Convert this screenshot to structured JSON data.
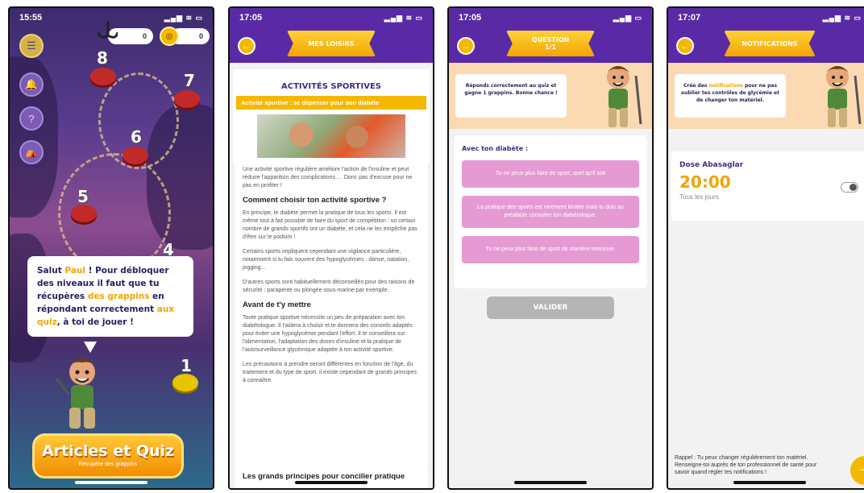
{
  "screen1": {
    "time": "15:55",
    "status_icons": "▂▄▆ ≋ ▭",
    "counter_left": "0",
    "counter_right": "0",
    "levels": [
      "8",
      "7",
      "6",
      "5",
      "4",
      "1"
    ],
    "speech": {
      "t1": "Salut ",
      "name": "Paul",
      "t2": " ! Pour débloquer des niveaux il faut que tu récupères ",
      "h1": "des grappins",
      "t3": " en répondant correctement ",
      "h2": "aux quiz",
      "t4": ", à toi de jouer !"
    },
    "cta_title": "Articles et Quiz",
    "cta_subtitle": "Récupère des grappins",
    "side_icons": [
      "menu-icon",
      "bell-icon",
      "question-icon",
      "tent-icon"
    ]
  },
  "screen2": {
    "time": "17:05",
    "status_icons": "▂▄▆ ≋ ▭",
    "header_title": "MES LOISIRS",
    "article_title": "ACTIVITÉS SPORTIVES",
    "subtitle_bar": "Activité sportive : se dépenser pour son diabète",
    "intro": "Une activité sportive régulière améliore l'action de l'insuline et peut réduire l'apparition des complications…. Donc pas d'excuse pour ne pas en profiter !",
    "h1": "Comment choisir ton activité sportive ?",
    "p1": "En principe, le diabète permet la pratique de tous les sports. Il est même tout à fait possible de faire du sport de compétition : un certain nombre de grands sportifs ont un diabète, et cela ne les empêche pas d'être sur le podium !",
    "p2": "Certains sports impliquent cependant une vigilance particulière, notamment si tu fais souvent des hypoglycémies : danse, natation, jogging…",
    "p3": "D'autres sports sont habituellement déconseillés pour des raisons de sécurité : parapente ou plongée sous-marine par exemple.",
    "h2": "Avant de t'y mettre",
    "p4": "Toute pratique sportive nécessite un peu de préparation avec ton diabétologue. Il t'aidera à choisir et te donnera des conseils adaptés pour éviter une hypoglycémie pendant l'effort. Il te conseillera sur l'alimentation, l'adaptation des doses d'insuline et la pratique de l'autosurveillance glycémique adaptée à ton activité sportive.",
    "p5": "Les précautions à prendre seront différentes en fonction de l'âge, du traitement et du type de sport, il existe cependant de grands principes à connaître.",
    "next_heading": "Les grands principes pour concilier pratique"
  },
  "screen3": {
    "time": "17:05",
    "status_icons": "▂▄▆ ▭",
    "header_line1": "QUESTION",
    "header_line2": "1/1",
    "instruction": "Réponds correctement au quiz et gagne 1 grappins. Bonne chance !",
    "question": "Avec ton diabète :",
    "answers": [
      "Tu ne peux plus faire de sport, quel qu'il soit",
      "La pratique des sports est rarement limitée mais tu dois au préalable consulter ton diabétologue.",
      "Tu ne peux plus faire de sport de manière intensive."
    ],
    "validate_label": "VALIDER"
  },
  "screen4": {
    "time": "17:07",
    "status_icons": "▂▄▆ ≋ ▭",
    "header_title": "NOTIFICATIONS",
    "info": {
      "t1": "Crée des ",
      "h1": "notifications",
      "t2": " pour ne pas oublier tes contrôles de glycémie et de changer ton matériel."
    },
    "dose_name": "Dose Abasaglar",
    "dose_time": "20:00",
    "dose_frequency": "Tous les jours",
    "reminder": "Rappel : Tu peux changer régulièrement ton matériel. Renseigne-toi auprès de ton professionnel de santé pour savoir quand régler tes notifications !",
    "fab_label": "+"
  },
  "colors": {
    "header_purple": "#5a2aa6",
    "accent_yellow": "#f5b800",
    "title_navy": "#3a2d8a",
    "answer_pink": "#e59ad3",
    "peach": "#fbd9b3"
  }
}
